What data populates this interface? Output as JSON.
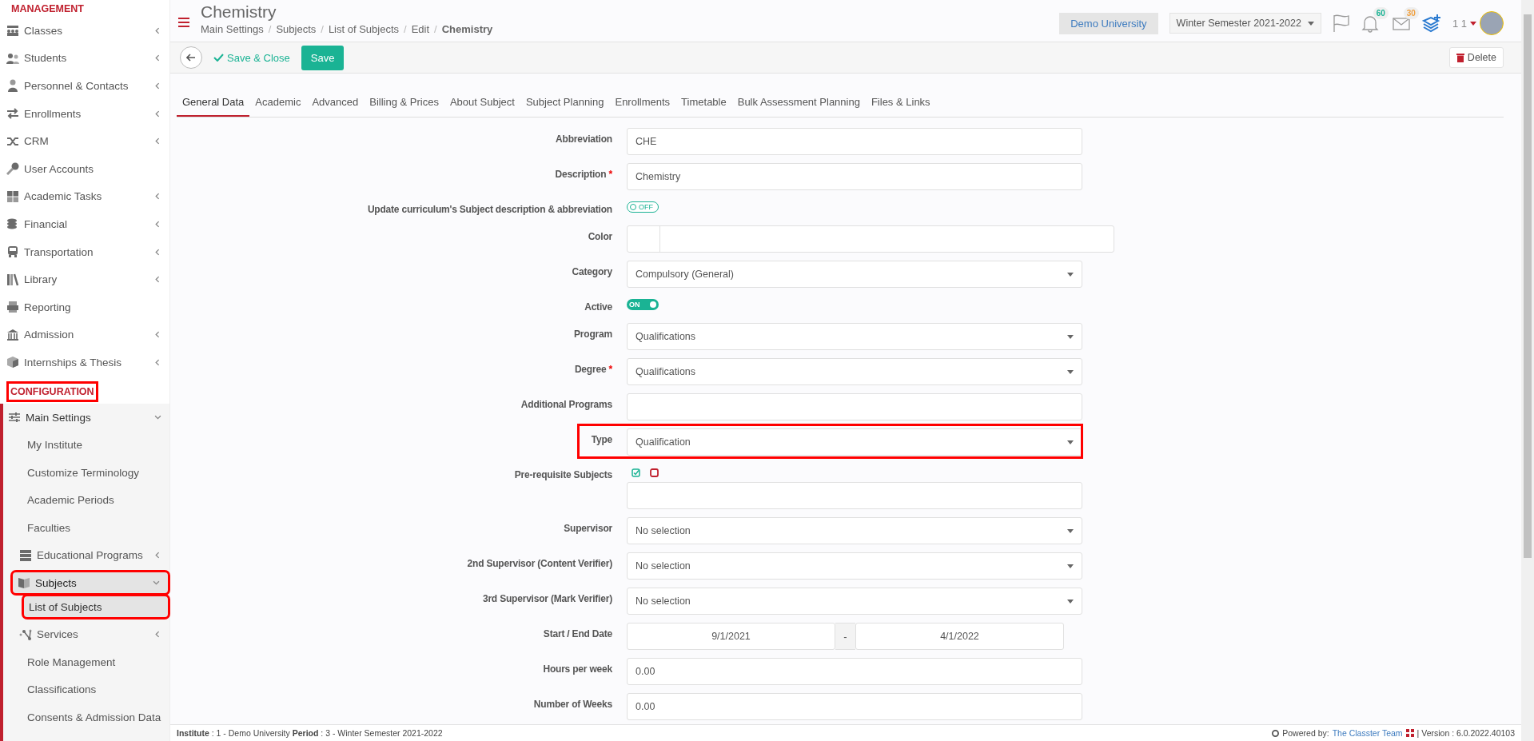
{
  "sidebar": {
    "sections": [
      {
        "title": "MANAGEMENT",
        "highlighted": false,
        "items": [
          {
            "label": "Classes",
            "has_children": true,
            "expanded": false,
            "selected": false,
            "highlighted": false
          },
          {
            "label": "Students",
            "has_children": true,
            "expanded": false,
            "selected": false,
            "highlighted": false
          },
          {
            "label": "Personnel & Contacts",
            "has_children": true,
            "expanded": false,
            "selected": false,
            "highlighted": false
          },
          {
            "label": "Enrollments",
            "has_children": true,
            "expanded": false,
            "selected": false,
            "highlighted": false
          },
          {
            "label": "CRM",
            "has_children": true,
            "expanded": false,
            "selected": false,
            "highlighted": false
          },
          {
            "label": "User Accounts",
            "has_children": false,
            "selected": false,
            "highlighted": false
          },
          {
            "label": "Academic Tasks",
            "has_children": true,
            "expanded": false,
            "selected": false,
            "highlighted": false
          },
          {
            "label": "Financial",
            "has_children": true,
            "expanded": false,
            "selected": false,
            "highlighted": false
          },
          {
            "label": "Transportation",
            "has_children": true,
            "expanded": false,
            "selected": false,
            "highlighted": false
          },
          {
            "label": "Library",
            "has_children": true,
            "expanded": false,
            "selected": false,
            "highlighted": false
          },
          {
            "label": "Reporting",
            "has_children": false,
            "selected": false,
            "highlighted": false
          },
          {
            "label": "Admission",
            "has_children": true,
            "expanded": false,
            "selected": false,
            "highlighted": false
          },
          {
            "label": "Internships & Thesis",
            "has_children": true,
            "expanded": false,
            "selected": false,
            "highlighted": false
          }
        ]
      },
      {
        "title": "CONFIGURATION",
        "highlighted": true,
        "items": [
          {
            "label": "Main Settings",
            "has_children": true,
            "expanded": true,
            "selected": false,
            "highlighted": false,
            "children": [
              {
                "label": "My Institute",
                "has_children": false,
                "selected": false,
                "highlighted": false
              },
              {
                "label": "Customize Terminology",
                "has_children": false,
                "selected": false,
                "highlighted": false
              },
              {
                "label": "Academic Periods",
                "has_children": false,
                "selected": false,
                "highlighted": false
              },
              {
                "label": "Faculties",
                "has_children": false,
                "selected": false,
                "highlighted": false
              },
              {
                "label": "Educational Programs",
                "has_children": true,
                "expanded": false,
                "selected": false,
                "highlighted": false
              },
              {
                "label": "Subjects",
                "has_children": true,
                "expanded": true,
                "selected": false,
                "highlighted": true,
                "children": [
                  {
                    "label": "List of Subjects",
                    "has_children": false,
                    "selected": true,
                    "highlighted": true
                  }
                ]
              },
              {
                "label": "Services",
                "has_children": true,
                "expanded": false,
                "selected": false,
                "highlighted": false
              },
              {
                "label": "Role Management",
                "has_children": false,
                "selected": false,
                "highlighted": false
              },
              {
                "label": "Classifications",
                "has_children": false,
                "selected": false,
                "highlighted": false
              },
              {
                "label": "Consents & Admission Data",
                "has_children": false,
                "selected": false,
                "highlighted": false
              }
            ]
          }
        ]
      }
    ]
  },
  "page": {
    "title": "Chemistry",
    "separator": "/",
    "breadcrumb": [
      "Main Settings",
      "Subjects",
      "List of Subjects",
      "Edit",
      "Chemistry"
    ]
  },
  "topbar": {
    "institution": "Demo University",
    "period": "Winter Semester 2021-2022",
    "notifications": "60",
    "messages": "30",
    "user": "1 1"
  },
  "toolbar": {
    "save_close": "Save & Close",
    "save": "Save",
    "delete": "Delete"
  },
  "tabs": [
    {
      "label": "General Data",
      "selected": true
    },
    {
      "label": "Academic",
      "selected": false
    },
    {
      "label": "Advanced",
      "selected": false
    },
    {
      "label": "Billing & Prices",
      "selected": false
    },
    {
      "label": "About Subject",
      "selected": false
    },
    {
      "label": "Subject Planning",
      "selected": false
    },
    {
      "label": "Enrollments",
      "selected": false
    },
    {
      "label": "Timetable",
      "selected": false
    },
    {
      "label": "Bulk Assessment Planning",
      "selected": false
    },
    {
      "label": "Files & Links",
      "selected": false
    }
  ],
  "form": {
    "required_mark": "*",
    "fields": [
      {
        "label": "Abbreviation",
        "kind": "text",
        "value": "CHE",
        "required": false,
        "highlighted": false
      },
      {
        "label": "Description",
        "kind": "text",
        "value": "Chemistry",
        "required": true,
        "highlighted": false
      },
      {
        "label": "Update curriculum's Subject description & abbreviation",
        "kind": "toggle",
        "on": false,
        "text": "OFF",
        "required": false,
        "highlighted": false
      },
      {
        "label": "Color",
        "kind": "color",
        "required": false,
        "highlighted": false
      },
      {
        "label": "Category",
        "kind": "select",
        "value": "Compulsory (General)",
        "required": false,
        "highlighted": false
      },
      {
        "label": "Active",
        "kind": "toggle",
        "on": true,
        "text": "ON",
        "required": false,
        "highlighted": false
      },
      {
        "label": "Program",
        "kind": "select",
        "value": "Qualifications",
        "required": false,
        "highlighted": false
      },
      {
        "label": "Degree",
        "kind": "select",
        "value": "Qualifications",
        "required": true,
        "highlighted": false
      },
      {
        "label": "Additional Programs",
        "kind": "multi",
        "required": false,
        "highlighted": false
      },
      {
        "label": "Type",
        "kind": "select",
        "value": "Qualification",
        "required": false,
        "highlighted": true
      },
      {
        "label": "Pre-requisite Subjects",
        "kind": "prereq",
        "required": false,
        "highlighted": false
      },
      {
        "label": "Supervisor",
        "kind": "select",
        "value": "No selection",
        "required": false,
        "highlighted": false
      },
      {
        "label": "2nd Supervisor (Content Verifier)",
        "kind": "select",
        "value": "No selection",
        "required": false,
        "highlighted": false
      },
      {
        "label": "3rd Supervisor (Mark Verifier)",
        "kind": "select",
        "value": "No selection",
        "required": false,
        "highlighted": false
      },
      {
        "label": "Start / End Date",
        "kind": "daterange",
        "start": "9/1/2021",
        "separator": "-",
        "end": "4/1/2022",
        "required": false,
        "highlighted": false
      },
      {
        "label": "Hours per week",
        "kind": "text",
        "value": "0.00",
        "required": false,
        "highlighted": false
      },
      {
        "label": "Number of Weeks",
        "kind": "text",
        "value": "0.00",
        "required": false,
        "highlighted": false
      }
    ]
  },
  "footer": {
    "info": "**Institute** : 1 - Demo University **Period** : 3 - Winter Semester 2021-2022",
    "powered": "Powered by:",
    "team": "The Classter Team",
    "version": "| Version : 6.0.2022.40103"
  }
}
